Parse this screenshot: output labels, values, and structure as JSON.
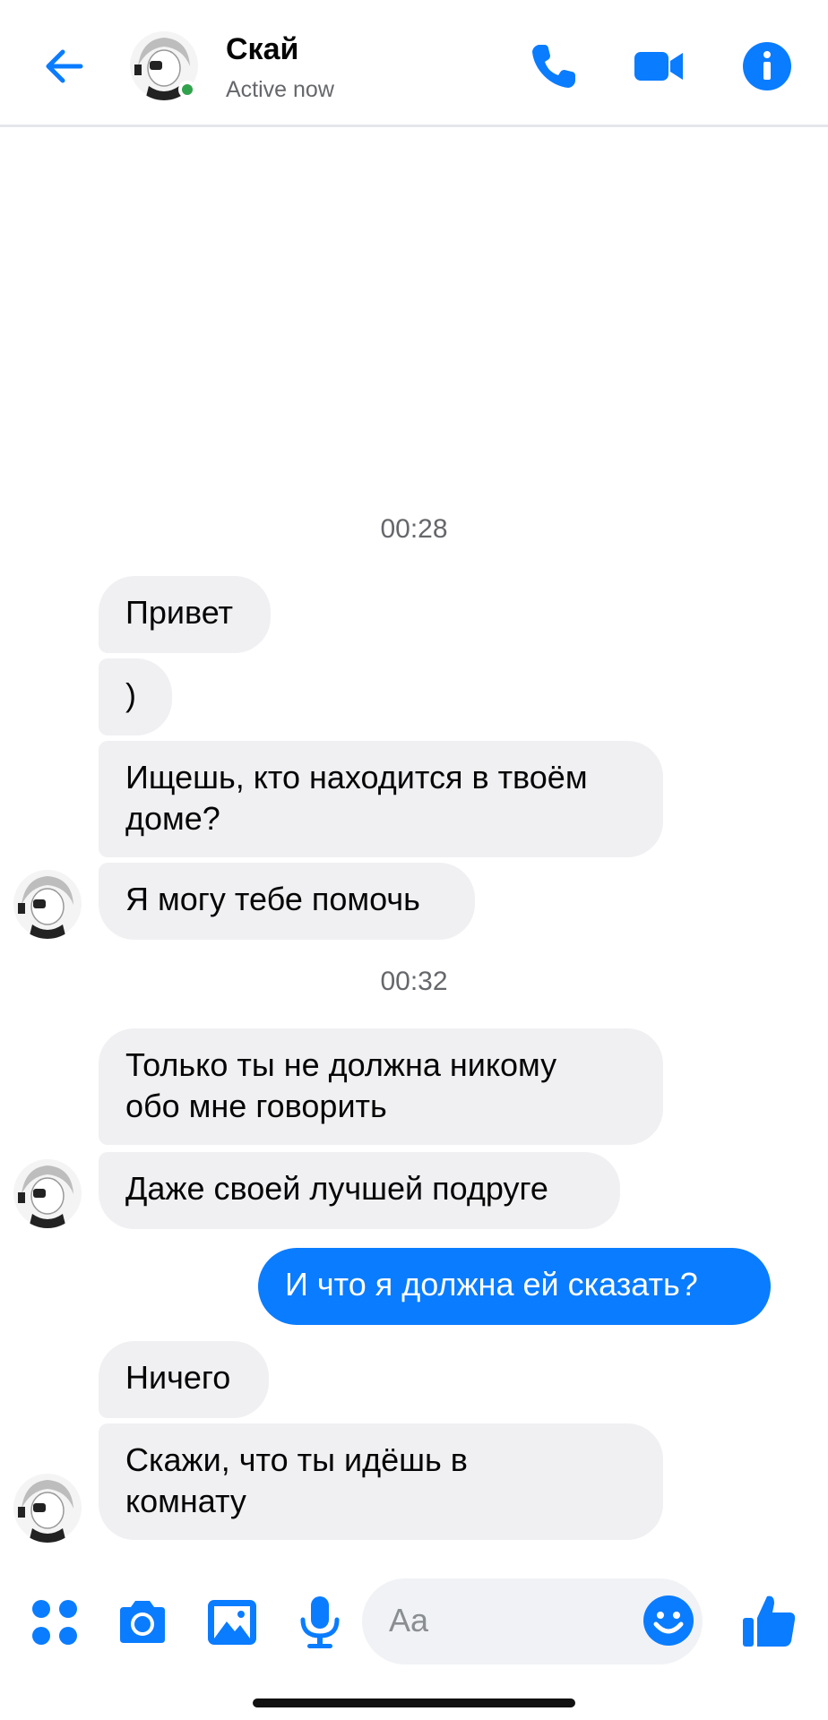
{
  "header": {
    "name": "Скай",
    "status": "Active now",
    "accent": "#0a7cff",
    "icons": [
      "back-arrow-icon",
      "phone-icon",
      "video-camera-icon",
      "info-icon"
    ]
  },
  "messages": [
    {
      "type": "time",
      "text": "00:28"
    },
    {
      "type": "in",
      "text": "Привет"
    },
    {
      "type": "in",
      "text": ")"
    },
    {
      "type": "in",
      "lines": [
        "Ищешь, кто находится в твоём",
        "доме?"
      ]
    },
    {
      "type": "in",
      "text": "Я могу тебе помочь"
    },
    {
      "type": "time",
      "text": "00:32"
    },
    {
      "type": "in",
      "lines": [
        "Только ты не должна никому",
        "обо мне говорить"
      ]
    },
    {
      "type": "in",
      "text": "Даже своей лучшей подруге"
    },
    {
      "type": "out",
      "text": "И что я должна ей сказать?"
    },
    {
      "type": "in",
      "text": "Ничего"
    },
    {
      "type": "in",
      "lines": [
        "Скажи, что ты идёшь в",
        "комнату"
      ]
    }
  ],
  "composer": {
    "placeholder": "Aa",
    "icons": [
      "menu-dots-icon",
      "camera-icon",
      "gallery-icon",
      "microphone-icon",
      "emoji-icon",
      "thumbs-up-icon"
    ]
  }
}
